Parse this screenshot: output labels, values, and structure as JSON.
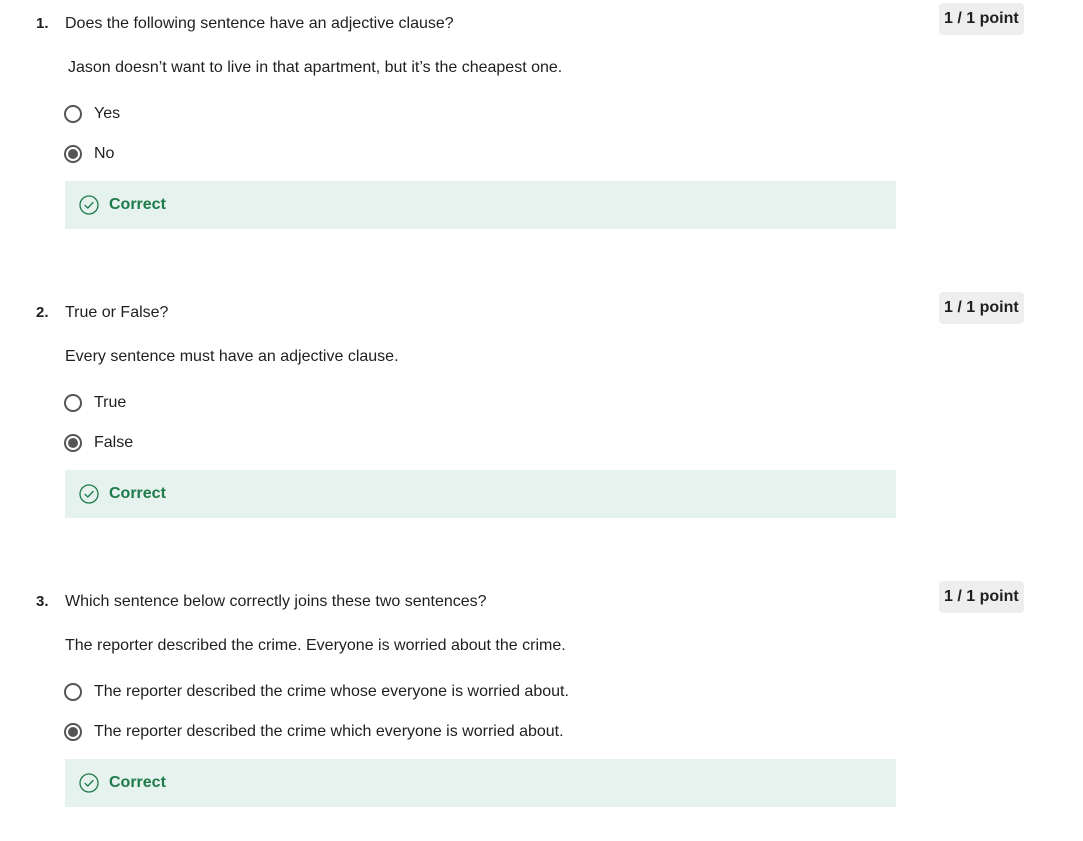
{
  "questions": [
    {
      "number": "1.",
      "title": "Does the following sentence have an adjective clause?",
      "points": "1 / 1 point",
      "prompt": "Jason doesn’t want to live in that apartment, but it’s the cheapest one.",
      "options": [
        {
          "label": "Yes",
          "selected": false
        },
        {
          "label": "No",
          "selected": true
        }
      ],
      "feedback": "Correct"
    },
    {
      "number": "2.",
      "title": "True or False?",
      "points": "1 / 1 point",
      "prompt": "Every sentence must have an adjective clause.",
      "options": [
        {
          "label": "True",
          "selected": false
        },
        {
          "label": "False",
          "selected": true
        }
      ],
      "feedback": "Correct"
    },
    {
      "number": "3.",
      "title": "Which sentence below correctly joins these two sentences?",
      "points": "1 / 1 point",
      "prompt": "The reporter described the crime. Everyone is worried about the crime.",
      "options": [
        {
          "label": "The reporter described the crime whose everyone is worried about.",
          "selected": false
        },
        {
          "label": "The reporter described the crime which everyone is worried about.",
          "selected": true
        }
      ],
      "feedback": "Correct"
    }
  ],
  "colors": {
    "feedback_bg": "#e6f2ee",
    "feedback_text": "#1f7a4a",
    "badge_bg": "#eeeeee",
    "radio": "#555555"
  },
  "icons": {
    "feedback_icon": "check-circle-icon"
  }
}
